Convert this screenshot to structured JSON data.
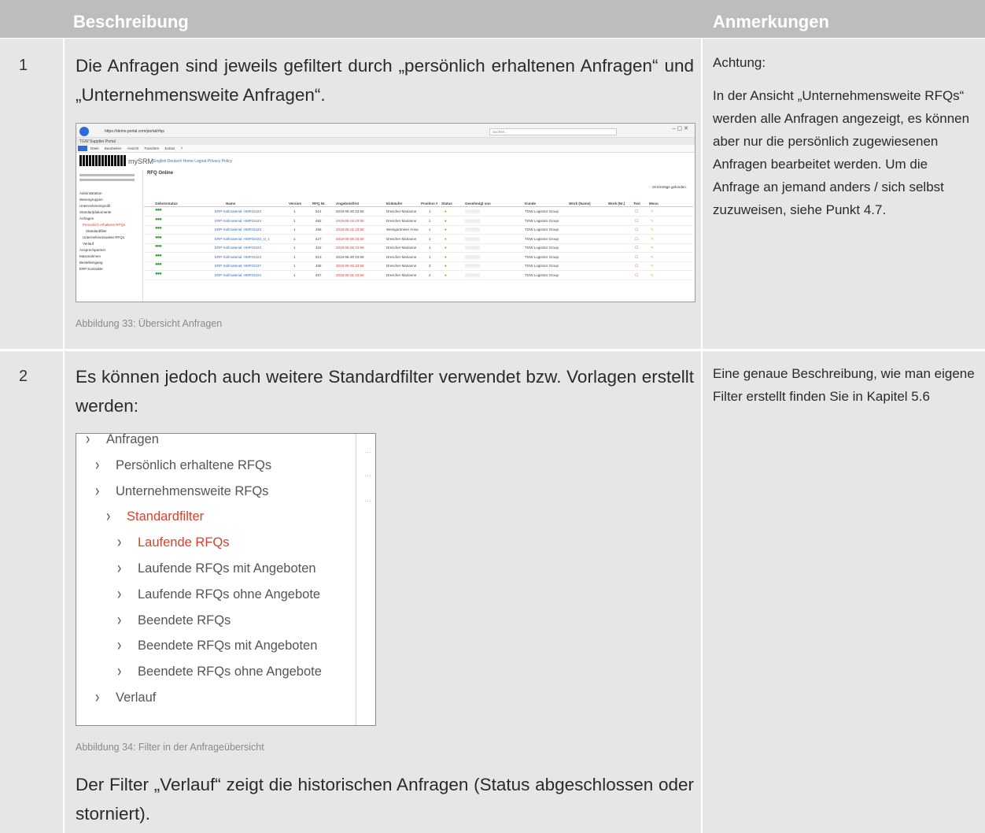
{
  "header": {
    "col_description": "Beschreibung",
    "col_notes": "Anmerkungen"
  },
  "rows": [
    {
      "number": "1",
      "description": "Die Anfragen sind jeweils gefiltert durch „persönlich erhaltenen Anfragen“ und „Unternehmensweite Anfragen“.",
      "caption": "Abbildung 33: Übersicht Anfragen",
      "notes": [
        "Achtung:",
        "In der Ansicht „Unternehmensweite RFQs“ werden alle Anfragen angezeigt, es können aber nur die persönlich zugewiesenen Anfragen bearbeitet werden. Um die Anfrage an jemand anders / sich selbst zuzuweisen, siehe Punkt 4.7."
      ]
    },
    {
      "number": "2",
      "description": "Es können jedoch auch weitere Standardfilter verwendet bzw. Vorlagen erstellt werden:",
      "caption": "Abbildung 34: Filter in der Anfrageübersicht",
      "after_text": "Der Filter „Verlauf“ zeigt die historischen Anfragen (Status abgeschlossen oder storniert).",
      "notes": [
        "Eine genaue Beschreibung, wie man eigene Filter erstellt finden Sie in Kapitel 5.6"
      ]
    }
  ],
  "screenshot1": {
    "address": "https://demo.portal.com/portal/rfqs",
    "search_placeholder": "Suchen...",
    "tab": "TGW Supplier Portal",
    "menu": [
      "Datei",
      "Bearbeiten",
      "Ansicht",
      "Favoriten",
      "Extras",
      "?"
    ],
    "logo_text": "mySRM",
    "top_links": "English   Deutsch   Home   Logout   Privacy Policy",
    "page_title": "RFQ Online",
    "entries_found": "19 Einträge gefunden.",
    "sidebar": [
      "Administration",
      "Warengruppen",
      "Unternehmensprofil",
      "Standarddokumente",
      "Anfragen",
      "Persönlich erhaltene RFQs",
      "Standardfilter",
      "Unternehmensweite RFQs",
      "Verlauf",
      "Ansprechpartner",
      "Massnahmen",
      "Bestelleingang",
      "ERP Kontrakte"
    ],
    "columns": [
      "Gebotsstatus",
      "Name",
      "Version",
      "RFQ Nr.",
      "Angebotsfrist",
      "Einkäufer",
      "Position #",
      "Status",
      "Genehmigt von",
      "Kunde",
      "Work (Name)",
      "Work (Nr.)",
      "Text",
      "Menu"
    ],
    "table_rows": [
      {
        "name": "ERP-Sollmaterial: HMF03423",
        "version": "1",
        "nr": "514",
        "deadline": "2019-06-30 23:59",
        "buyer": "Drescher Marianne",
        "pos": "1",
        "customer": "TGW Logistics Group",
        "red": false
      },
      {
        "name": "ERP-Sollmaterial: HMF03423",
        "version": "1",
        "nr": "482",
        "deadline": "2019-06-19 23:59",
        "buyer": "Drescher Marianne",
        "pos": "1",
        "customer": "TGW Logistics Group",
        "red": true
      },
      {
        "name": "ERP-Sollmaterial: HMF03423",
        "version": "1",
        "nr": "458",
        "deadline": "2019-06-21 23:59",
        "buyer": "Weingartmeier Anna",
        "pos": "1",
        "customer": "TGW Logistics Group",
        "red": true
      },
      {
        "name": "ERP-Sollmaterial: HMF03423_sl_1",
        "version": "1",
        "nr": "427",
        "deadline": "2019-06-08 23:59",
        "buyer": "Drescher Marianne",
        "pos": "1",
        "customer": "TGW Logistics Group",
        "red": true
      },
      {
        "name": "ERP-Sollmaterial: HMF03423",
        "version": "1",
        "nr": "422",
        "deadline": "2019-05-29 23:59",
        "buyer": "Drescher Marianne",
        "pos": "1",
        "customer": "TGW Logistics Group",
        "red": true
      },
      {
        "name": "ERP-Sollmaterial: HMF03423",
        "version": "1",
        "nr": "513",
        "deadline": "2019-06-30 23:59",
        "buyer": "Drescher Marianne",
        "pos": "1",
        "customer": "TGW Logistics Group",
        "red": false
      },
      {
        "name": "ERP-Sollmaterial: HMF03437",
        "version": "1",
        "nr": "465",
        "deadline": "2019-06-20 23:59",
        "buyer": "Drescher Marianne",
        "pos": "3",
        "customer": "TGW Logistics Group",
        "red": true
      },
      {
        "name": "ERP-Sollmaterial: HMF03434",
        "version": "1",
        "nr": "457",
        "deadline": "2019-05-31 23:59",
        "buyer": "Drescher Marianne",
        "pos": "2",
        "customer": "TGW Logistics Group",
        "red": true
      }
    ]
  },
  "screenshot2": {
    "items": [
      {
        "label": "Anfragen",
        "level": 0,
        "active": false
      },
      {
        "label": "Persönlich erhaltene RFQs",
        "level": 1,
        "active": false
      },
      {
        "label": "Unternehmensweite RFQs",
        "level": 1,
        "active": false
      },
      {
        "label": "Standardfilter",
        "level": 2,
        "active": true
      },
      {
        "label": "Laufende RFQs",
        "level": 3,
        "active": true
      },
      {
        "label": "Laufende RFQs mit Angeboten",
        "level": 3,
        "active": false
      },
      {
        "label": "Laufende RFQs ohne Angebote",
        "level": 3,
        "active": false
      },
      {
        "label": "Beendete RFQs",
        "level": 3,
        "active": false
      },
      {
        "label": "Beendete RFQs mit Angeboten",
        "level": 3,
        "active": false
      },
      {
        "label": "Beendete RFQs ohne Angebote",
        "level": 3,
        "active": false
      },
      {
        "label": "Verlauf",
        "level": 1,
        "active": false
      }
    ]
  }
}
